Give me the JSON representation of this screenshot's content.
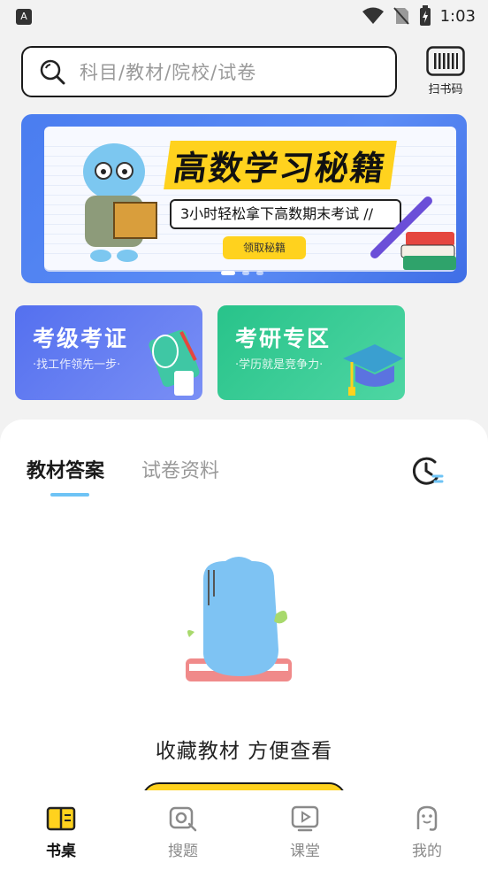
{
  "status_bar": {
    "time": "1:03",
    "left_icon": "A"
  },
  "header": {
    "search_placeholder": "科目/教材/院校/试卷",
    "scan_label": "扫书码"
  },
  "banner": {
    "title": "高数学习秘籍",
    "subtitle": "3小时轻松拿下高数期末考试 //",
    "button": "领取秘籍",
    "slides": 3,
    "active_slide": 1
  },
  "cards": [
    {
      "title": "考级考证",
      "subtitle": "·找工作领先一步·",
      "color": "#5470ef"
    },
    {
      "title": "考研专区",
      "subtitle": "·学历就是竞争力·",
      "color": "#28c38a"
    }
  ],
  "tabs": [
    {
      "label": "教材答案",
      "active": true
    },
    {
      "label": "试卷资料",
      "active": false
    }
  ],
  "empty_state": {
    "message": "收藏教材  方便查看"
  },
  "bottom_nav": [
    {
      "label": "书桌",
      "icon": "desk-book-icon",
      "active": true
    },
    {
      "label": "搜题",
      "icon": "search-question-icon",
      "active": false
    },
    {
      "label": "课堂",
      "icon": "video-play-icon",
      "active": false
    },
    {
      "label": "我的",
      "icon": "profile-mascot-icon",
      "active": false
    }
  ],
  "colors": {
    "accent_yellow": "#ffd21e",
    "tab_underline": "#6ec3f5",
    "banner_blue": "#4a7df0"
  }
}
